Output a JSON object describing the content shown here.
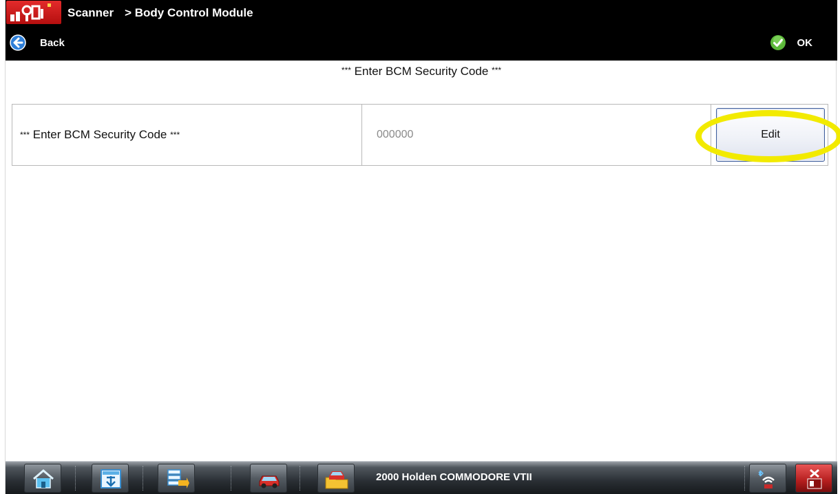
{
  "titlebar": {
    "app": "Scanner",
    "current": "> Body Control Module"
  },
  "toolbar": {
    "back_label": "Back",
    "ok_label": "OK"
  },
  "screen": {
    "heading": "Enter BCM Security Code",
    "heading_stars": "***"
  },
  "table": {
    "row": {
      "label_stars": "***",
      "label": "Enter BCM Security Code",
      "value": "000000",
      "button": "Edit"
    }
  },
  "taskbar": {
    "vehicle": "2000 Holden COMMODORE VTII",
    "icons": [
      "home-icon",
      "data-manager-icon",
      "tools-icon",
      "vehicle-red-icon",
      "vehicle-folder-icon",
      "bluetooth-signal-icon",
      "exit-icon"
    ]
  },
  "colors": {
    "highlight": "#f2ea00",
    "titlebar": "#000000",
    "logo_red": "#d42020"
  }
}
